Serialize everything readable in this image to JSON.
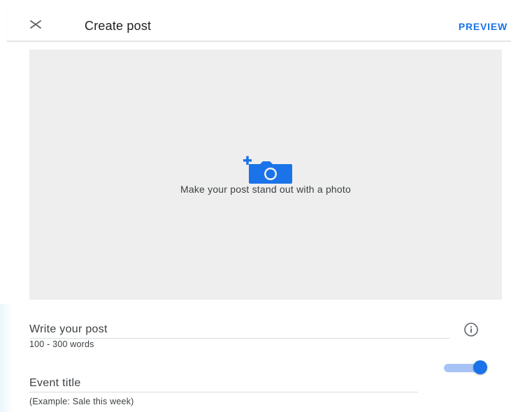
{
  "header": {
    "title": "Create post",
    "preview_label": "PREVIEW",
    "close_icon": "close-icon"
  },
  "photo": {
    "prompt": "Make your post stand out with a photo",
    "icon": "add-photo-icon"
  },
  "post_field": {
    "placeholder": "Write your post",
    "helper": "100 - 300 words",
    "info_icon": "info-icon"
  },
  "event_toggle": {
    "state": "on"
  },
  "event_field": {
    "placeholder": "Event title",
    "helper": "(Example: Sale this week)"
  },
  "colors": {
    "accent": "#1a73e8",
    "photo_bg": "#eeeeee",
    "text": "#202124"
  }
}
